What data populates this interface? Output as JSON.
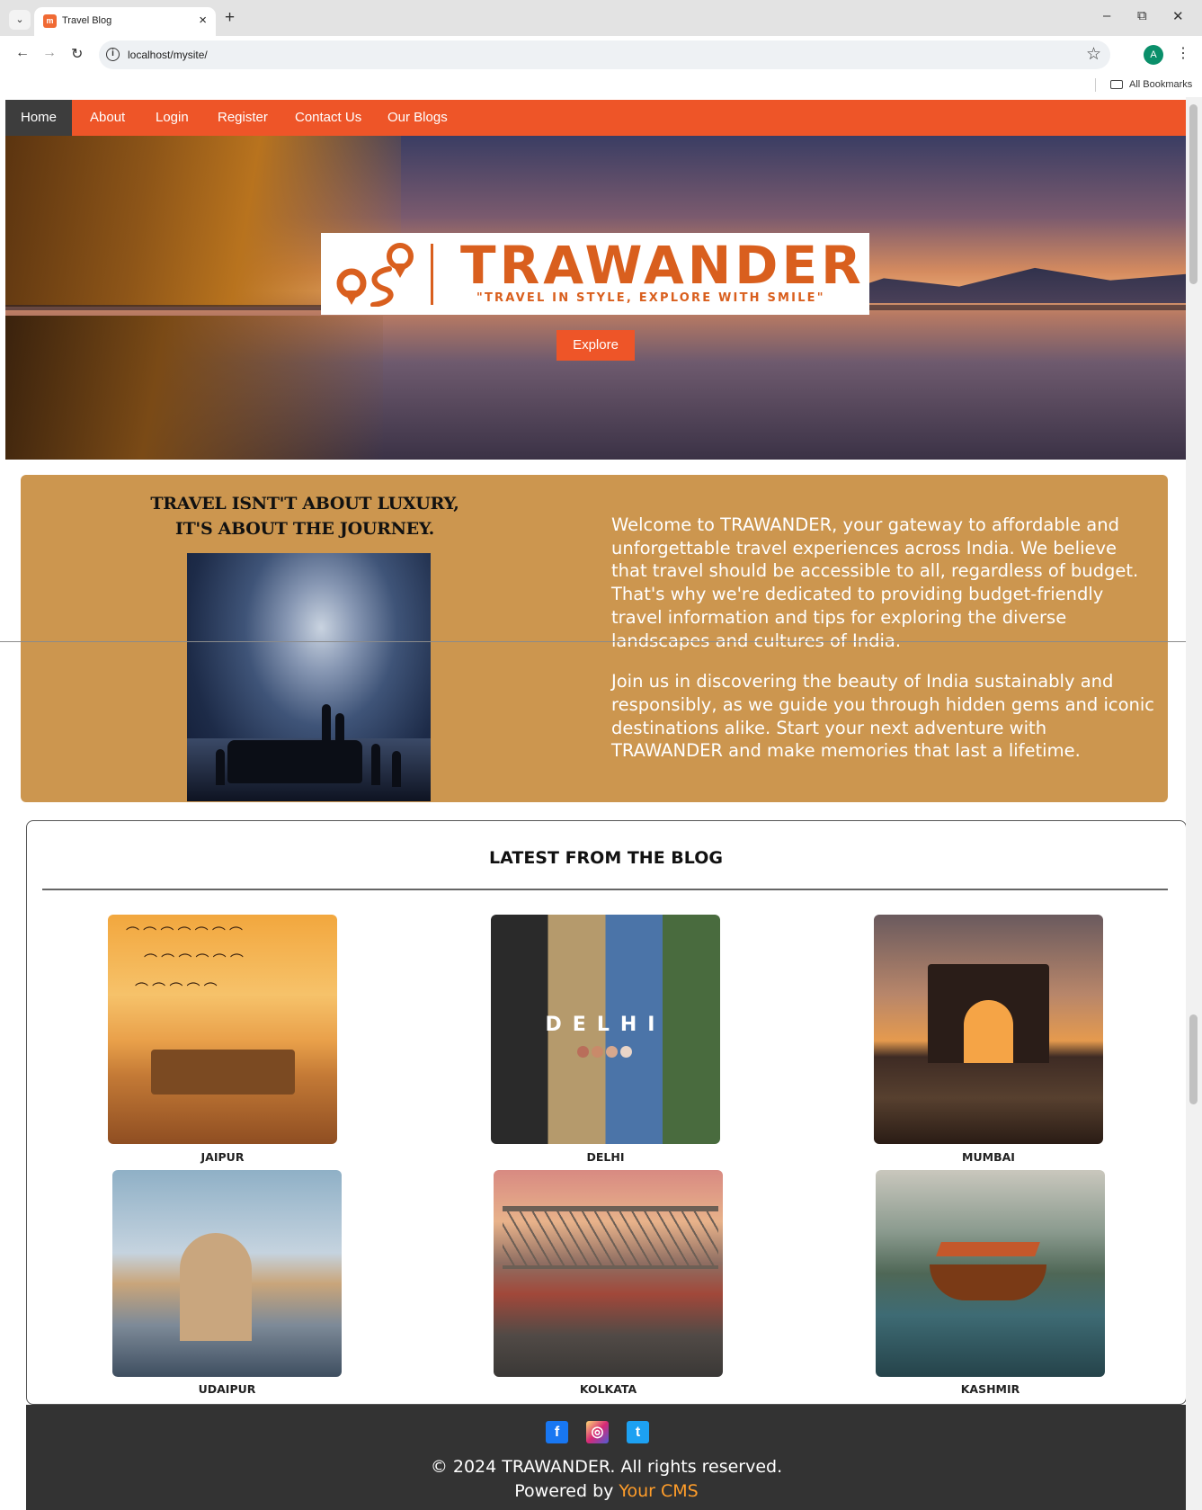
{
  "browser": {
    "tab_title": "Travel Blog",
    "favicon_text": "m",
    "new_tab_label": "+",
    "url": "localhost/mysite/",
    "profile_initial": "A",
    "bookmarks_label": "All Bookmarks",
    "minimize_label": "–",
    "restore_label": "⧉",
    "close_label": "✕"
  },
  "nav": {
    "items": [
      {
        "label": "Home",
        "active": true
      },
      {
        "label": "About"
      },
      {
        "label": "Login"
      },
      {
        "label": "Register"
      },
      {
        "label": "Contact Us"
      },
      {
        "label": "Our Blogs"
      }
    ],
    "color": "#ee5528"
  },
  "hero": {
    "brand": "TRAWANDER",
    "tagline": "\"TRAVEL IN STYLE, EXPLORE WITH SMILE\"",
    "button_label": "Explore",
    "brand_color": "#d95f1e"
  },
  "about": {
    "quote_line1": "TRAVEL ISNT'T ABOUT LUXURY,",
    "quote_line2": "IT'S ABOUT THE JOURNEY.",
    "paragraph1": "Welcome to TRAWANDER, your gateway to affordable and unforgettable travel experiences across India. We believe that travel should be accessible to all, regardless of budget. That's why we're dedicated to providing budget-friendly travel information and tips for exploring the diverse landscapes and cultures of India.",
    "paragraph2": "Join us in discovering the beauty of India sustainably and responsibly, as we guide you through hidden gems and iconic destinations alike. Start your next adventure with TRAWANDER and make memories that last a lifetime.",
    "background": "#cc964f"
  },
  "blog": {
    "title": "LATEST FROM THE BLOG",
    "cards": [
      {
        "label": "JAIPUR"
      },
      {
        "label": "DELHI",
        "image_text": "DELHI"
      },
      {
        "label": "MUMBAI"
      },
      {
        "label": "UDAIPUR"
      },
      {
        "label": "KOLKATA"
      },
      {
        "label": "KASHMIR"
      }
    ]
  },
  "footer": {
    "social": [
      {
        "icon": "facebook-icon",
        "glyph": "f"
      },
      {
        "icon": "instagram-icon",
        "glyph": "◎"
      },
      {
        "icon": "twitter-icon",
        "glyph": "t"
      }
    ],
    "copyright": "© 2024 TRAWANDER. All rights reserved.",
    "powered_prefix": "Powered by",
    "powered_link": "Your CMS",
    "link_color": "#ff9d2a"
  }
}
